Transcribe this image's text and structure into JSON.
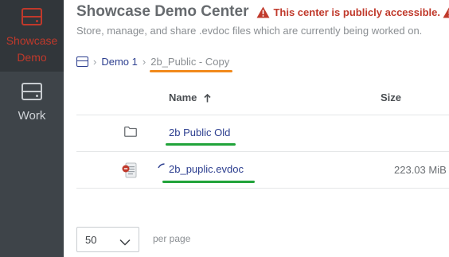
{
  "sidebar": {
    "items": [
      {
        "label": "Showcase Demo",
        "icon": "drive-icon",
        "active": true
      },
      {
        "label": "Work",
        "icon": "drive-icon",
        "active": false
      }
    ]
  },
  "header": {
    "title": "Showcase Demo Center",
    "warning": "This center is publicly accessible.",
    "subtitle": "Store, manage, and share .evdoc files which are currently being worked on."
  },
  "breadcrumb": {
    "home_icon": "drive-icon",
    "items": [
      "Demo 1",
      "2b_Public - Copy"
    ]
  },
  "table": {
    "columns": {
      "name": "Name",
      "size": "Size"
    },
    "sort": "ascending",
    "rows": [
      {
        "type": "folder",
        "icon": "folder-icon",
        "name": "2b Public Old",
        "size": ""
      },
      {
        "type": "file",
        "icon": "evdoc-file-icon",
        "name": "2b_puplic.evdoc",
        "size": "223.03 MiB",
        "loading": true
      }
    ]
  },
  "pagination": {
    "per_page_value": "50",
    "per_page_label": "per page"
  },
  "colors": {
    "sidebar_bg": "#3e4449",
    "accent_red": "#c0392b",
    "link_blue": "#2c3e8f",
    "highlight_orange": "#f28a1c",
    "highlight_green": "#21a33a"
  }
}
